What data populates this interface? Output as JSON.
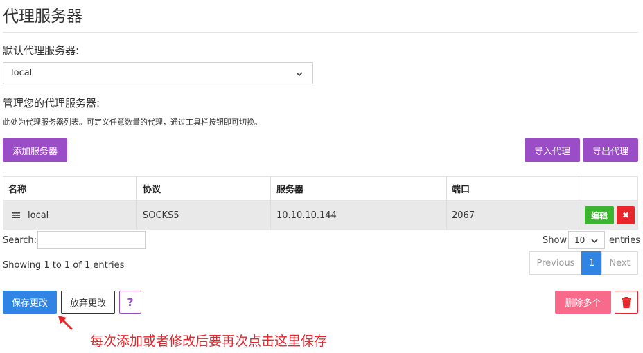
{
  "page": {
    "title": "代理服务器"
  },
  "default_proxy": {
    "label": "默认代理服务器:",
    "selected": "local"
  },
  "manage": {
    "label": "管理您的代理服务器:",
    "description": "此处为代理服务器列表。可定义任意数量的代理，通过工具栏按钮即可切换。"
  },
  "toolbar": {
    "add_label": "添加服务器",
    "import_label": "导入代理",
    "export_label": "导出代理"
  },
  "table": {
    "headers": [
      "名称",
      "协议",
      "服务器",
      "端口",
      ""
    ],
    "rows": [
      {
        "name": "local",
        "protocol": "SOCKS5",
        "server": "10.10.10.144",
        "port": "2067",
        "edit_label": "编辑",
        "delete_label": "✖"
      }
    ]
  },
  "search": {
    "label": "Search:",
    "value": ""
  },
  "length": {
    "show_label": "Show",
    "value": "10",
    "entries_label": "entries"
  },
  "info": "Showing 1 to 1 of 1 entries",
  "pagination": {
    "previous": "Previous",
    "current": "1",
    "next": "Next"
  },
  "footer": {
    "save_label": "保存更改",
    "discard_label": "放弃更改",
    "help_label": "?",
    "delete_multi_label": "删除多个"
  },
  "annotation": "每次添加或者修改后要再次点击这里保存",
  "colors": {
    "purple": "#9b4dc8",
    "blue": "#2f84e4",
    "green": "#3bb52f",
    "red": "#e8262c",
    "pink": "#f76a8a"
  }
}
